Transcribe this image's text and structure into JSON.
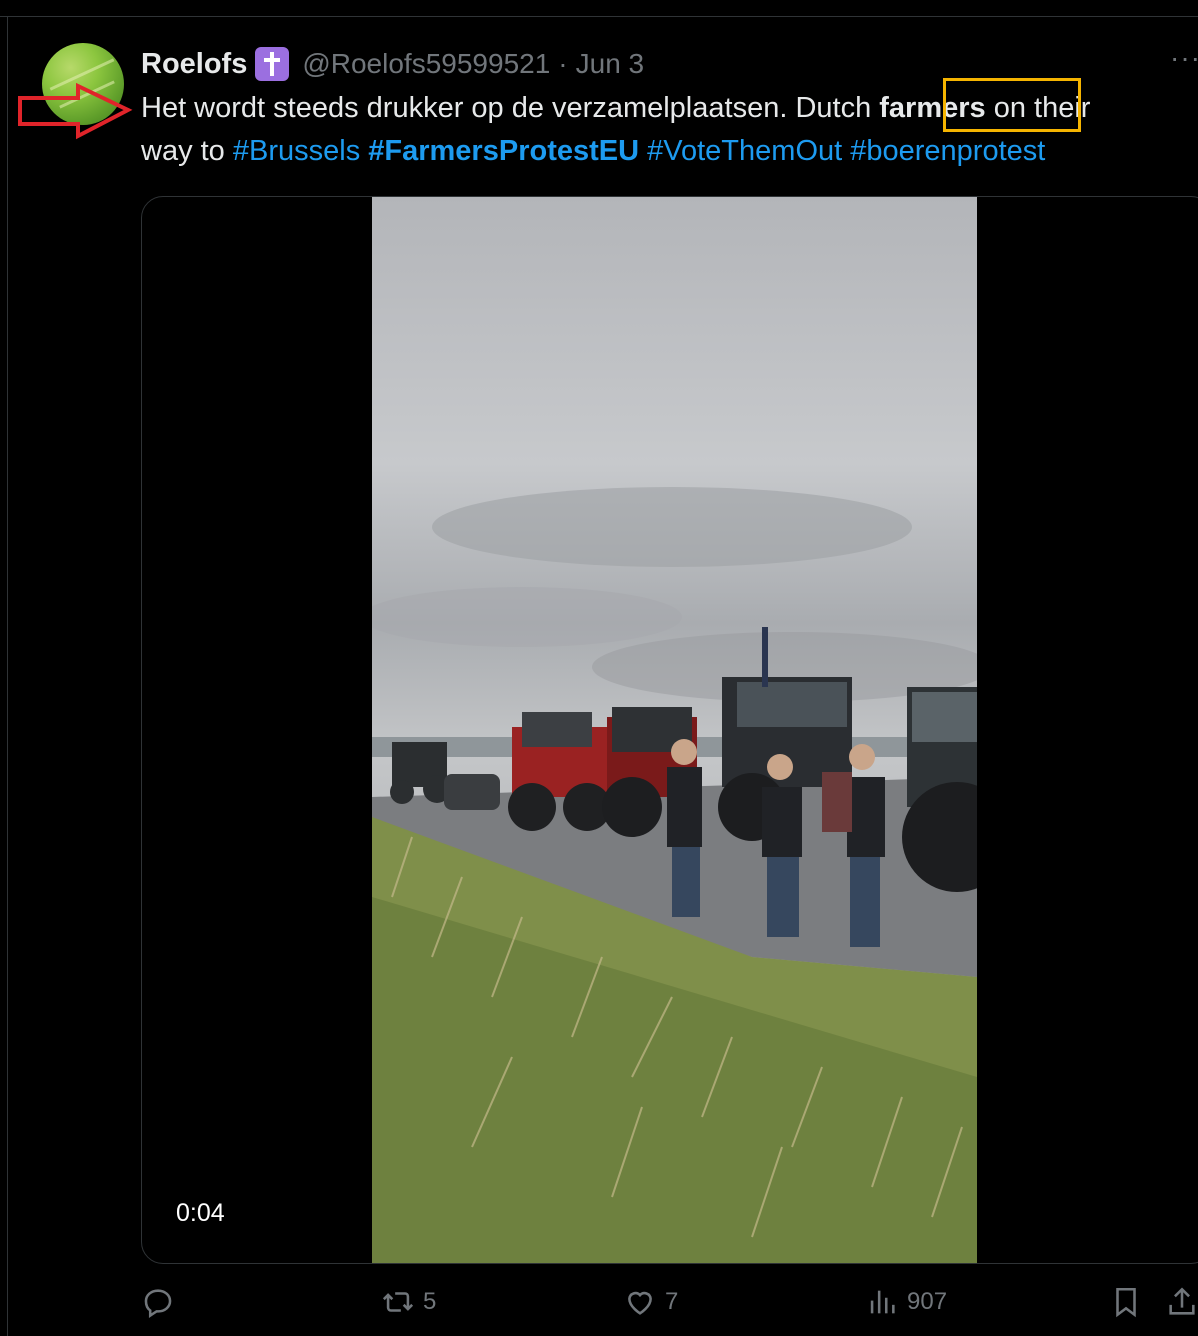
{
  "tweet": {
    "author_name": "Roelofs",
    "badge_icon": "latin-cross-icon",
    "handle": "@Roelofs59599521",
    "separator": "·",
    "date": "Jun 3",
    "more_label": "···",
    "text_part1": "Het wordt steeds drukker op de verzamelplaatsen. Dutch ",
    "text_keyword": "farmers",
    "text_part2": " on their",
    "text_line2_start": "way to ",
    "hashtags": [
      "#Brussels",
      "#FarmersProtestEU",
      "#VoteThemOut",
      "#boerenprotest"
    ]
  },
  "media": {
    "timecode": "0:04"
  },
  "actions": {
    "reply_count": "",
    "retweet_count": "5",
    "like_count": "7",
    "views_count": "907"
  },
  "annotations": {
    "arrow_color": "#e0242a",
    "highlight_color": "#f5b400"
  },
  "colors": {
    "background": "#000000",
    "text": "#e7e9ea",
    "muted": "#71767b",
    "link": "#1d9bf0",
    "badge": "#9b6fe0"
  }
}
